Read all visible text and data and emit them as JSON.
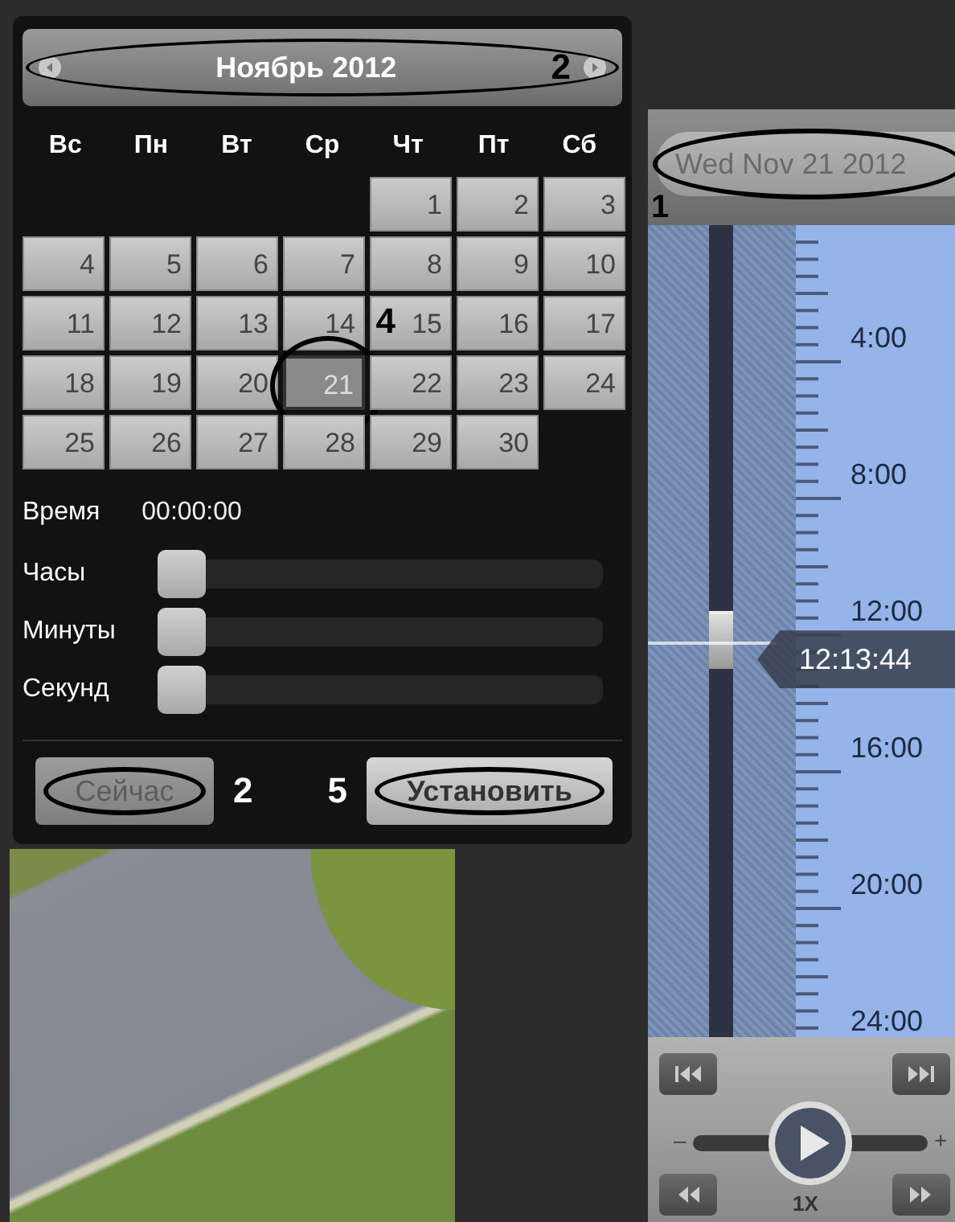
{
  "calendar": {
    "header": {
      "title": "Ноябрь 2012",
      "callout": "2"
    },
    "weekdays": [
      "Вс",
      "Пн",
      "Вт",
      "Ср",
      "Чт",
      "Пт",
      "Сб"
    ],
    "weeks": [
      {
        "kind": "leading",
        "days": [
          {
            "day": "1",
            "selected": false
          },
          {
            "day": "2",
            "selected": false
          },
          {
            "day": "3",
            "selected": false
          }
        ]
      },
      {
        "kind": "regular",
        "days": [
          {
            "day": "4",
            "selected": false
          },
          {
            "day": "5",
            "selected": false
          },
          {
            "day": "6",
            "selected": false
          },
          {
            "day": "7",
            "selected": false
          },
          {
            "day": "8",
            "selected": false
          },
          {
            "day": "9",
            "selected": false
          },
          {
            "day": "10",
            "selected": false
          }
        ]
      },
      {
        "kind": "regular",
        "days": [
          {
            "day": "11",
            "selected": false
          },
          {
            "day": "12",
            "selected": false
          },
          {
            "day": "13",
            "selected": false
          },
          {
            "day": "14",
            "selected": false
          },
          {
            "day": "15",
            "selected": false
          },
          {
            "day": "16",
            "selected": false
          },
          {
            "day": "17",
            "selected": false
          }
        ]
      },
      {
        "kind": "regular",
        "days": [
          {
            "day": "18",
            "selected": false
          },
          {
            "day": "19",
            "selected": false
          },
          {
            "day": "20",
            "selected": false
          },
          {
            "day": "21",
            "selected": true,
            "callout": "4"
          },
          {
            "day": "22",
            "selected": false
          },
          {
            "day": "23",
            "selected": false
          },
          {
            "day": "24",
            "selected": false
          }
        ]
      },
      {
        "kind": "regular",
        "days": [
          {
            "day": "25",
            "selected": false
          },
          {
            "day": "26",
            "selected": false
          },
          {
            "day": "27",
            "selected": false
          },
          {
            "day": "28",
            "selected": false
          },
          {
            "day": "29",
            "selected": false
          },
          {
            "day": "30",
            "selected": false
          }
        ]
      }
    ],
    "time": {
      "label": "Время",
      "value": "00:00:00"
    },
    "sliders": [
      {
        "label": "Часы",
        "level": 0
      },
      {
        "label": "Минуты",
        "level": 0
      },
      {
        "label": "Секунд",
        "level": 0
      }
    ],
    "buttons": [
      {
        "label": "Сейчас",
        "disabled": true,
        "bold": false,
        "callout": "2"
      },
      {
        "label": "Установить",
        "disabled": false,
        "bold": true,
        "callout": "5"
      }
    ]
  },
  "timeline": {
    "date_field": {
      "value": "Wed Nov 21 2012",
      "callout": "1"
    },
    "ticks": [
      "4:00",
      "8:00",
      "12:00",
      "16:00",
      "20:00",
      "24:00"
    ],
    "position": {
      "time": "12:13:44",
      "level": 0.51
    },
    "speed": {
      "level": 0.5,
      "minus": "–",
      "plus": "+",
      "label": "1X"
    }
  }
}
